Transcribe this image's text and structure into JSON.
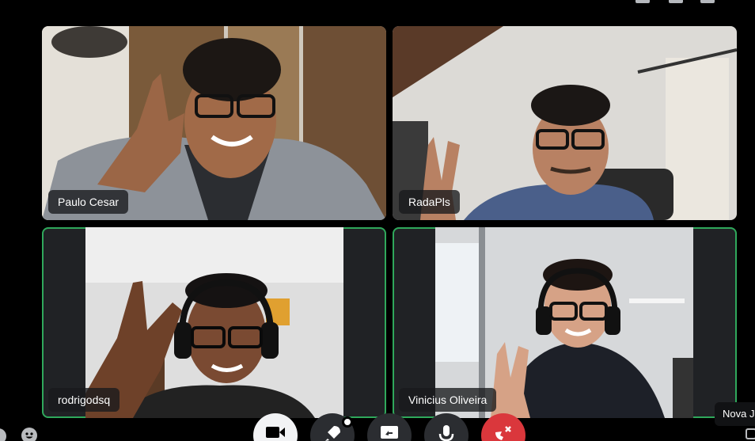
{
  "participants": [
    {
      "name": "Paulo Cesar",
      "speaking": false
    },
    {
      "name": "RadaPls",
      "speaking": false
    },
    {
      "name": "rodrigodsq",
      "speaking": true
    },
    {
      "name": "Vinicius Oliveira",
      "speaking": true
    }
  ],
  "controls": {
    "camera": "video-camera-icon",
    "activities": "rocket-icon",
    "share_screen": "screen-share-icon",
    "microphone": "microphone-icon",
    "leave": "disconnect-icon"
  },
  "tooltip": "Nova J",
  "colors": {
    "background": "#000000",
    "tile_background": "#202225",
    "speaking_outline": "#2fa85b",
    "leave_button": "#da373c",
    "control_button": "#2b2d31"
  }
}
